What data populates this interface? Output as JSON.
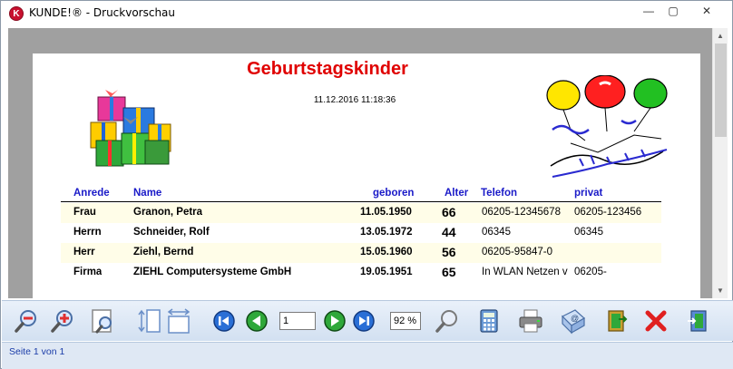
{
  "window": {
    "app_icon_letter": "K",
    "title": "KUNDE!® - Druckvorschau",
    "min_glyph": "—",
    "max_glyph": "▢",
    "close_glyph": "✕"
  },
  "report": {
    "title": "Geburtstagskinder",
    "date": "11.12.2016 11:18:36",
    "headers": {
      "anrede": "Anrede",
      "name": "Name",
      "geboren": "geboren",
      "alter": "Alter",
      "telefon": "Telefon",
      "privat": "privat"
    },
    "rows": [
      {
        "anrede": "Frau",
        "name": "Granon, Petra",
        "geboren": "11.05.1950",
        "alter": "66",
        "telefon": "06205-12345678",
        "privat": "06205-123456"
      },
      {
        "anrede": "Herrn",
        "name": "Schneider, Rolf",
        "geboren": "13.05.1972",
        "alter": "44",
        "telefon": "06345",
        "privat": "06345"
      },
      {
        "anrede": "Herr",
        "name": "Ziehl, Bernd",
        "geboren": "15.05.1960",
        "alter": "56",
        "telefon": "06205-95847-0",
        "privat": ""
      },
      {
        "anrede": "Firma",
        "name": "ZIEHL Computersysteme GmbH",
        "geboren": "19.05.1951",
        "alter": "65",
        "telefon": "In WLAN Netzen v",
        "privat": "06205-"
      }
    ]
  },
  "toolbar": {
    "page_value": "1",
    "zoom_value": "92 %",
    "icons": [
      "zoom-out-icon",
      "zoom-in-icon",
      "zoom-page-icon",
      "page-height-icon",
      "page-width-icon",
      "first-page-icon",
      "prev-page-icon",
      "next-page-icon",
      "last-page-icon",
      "search-icon",
      "calculator-icon",
      "printer-icon",
      "email-icon",
      "export-icon",
      "close-icon",
      "exit-icon"
    ]
  },
  "status": {
    "text": "Seite 1 von 1"
  },
  "colors": {
    "title_red": "#e00000",
    "header_blue": "#1a1ac8",
    "row_shade": "#fffde8",
    "toolbar_top": "#eaf1fa",
    "status_text": "#1a3ca8"
  }
}
